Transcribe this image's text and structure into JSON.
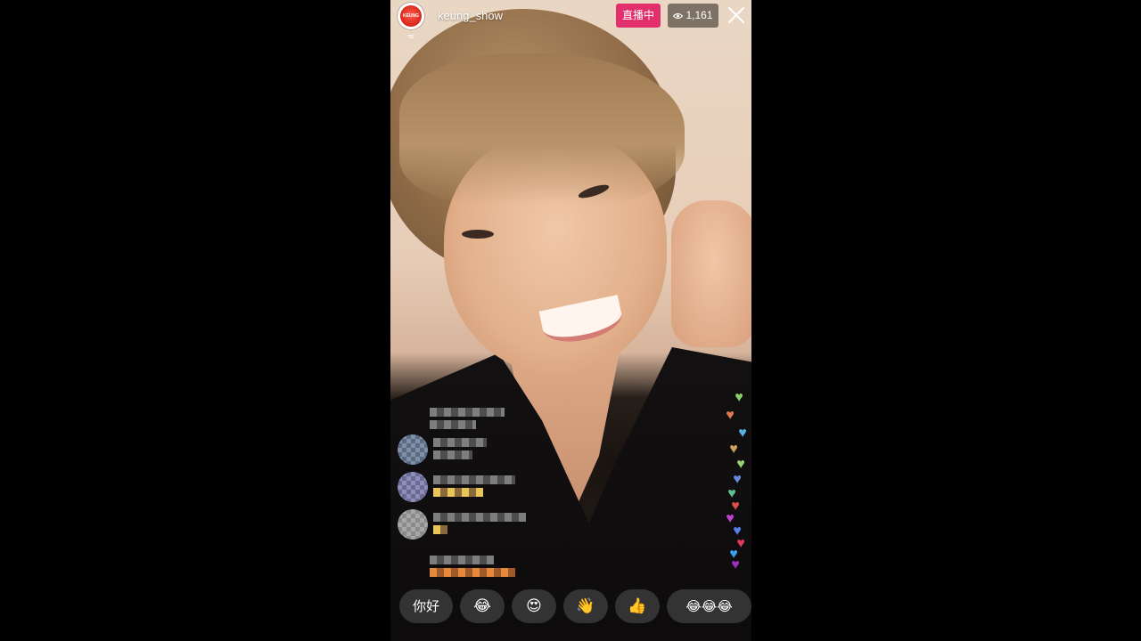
{
  "header": {
    "username": "keung_show",
    "avatar_text": "KEUNG TO",
    "live_label": "直播中",
    "viewer_count": "1,161"
  },
  "quick_reactions": [
    "你好",
    "😂",
    "😍",
    "👋",
    "👍",
    "😂😂😂"
  ],
  "hearts": [
    "♥",
    "♥",
    "♥",
    "♥",
    "♥",
    "♥",
    "♥",
    "♥",
    "♥",
    "♥",
    "♥",
    "♥",
    "♥"
  ],
  "colors": {
    "live_badge": "#e1306c",
    "chip_bg": "#3c3c3c"
  }
}
